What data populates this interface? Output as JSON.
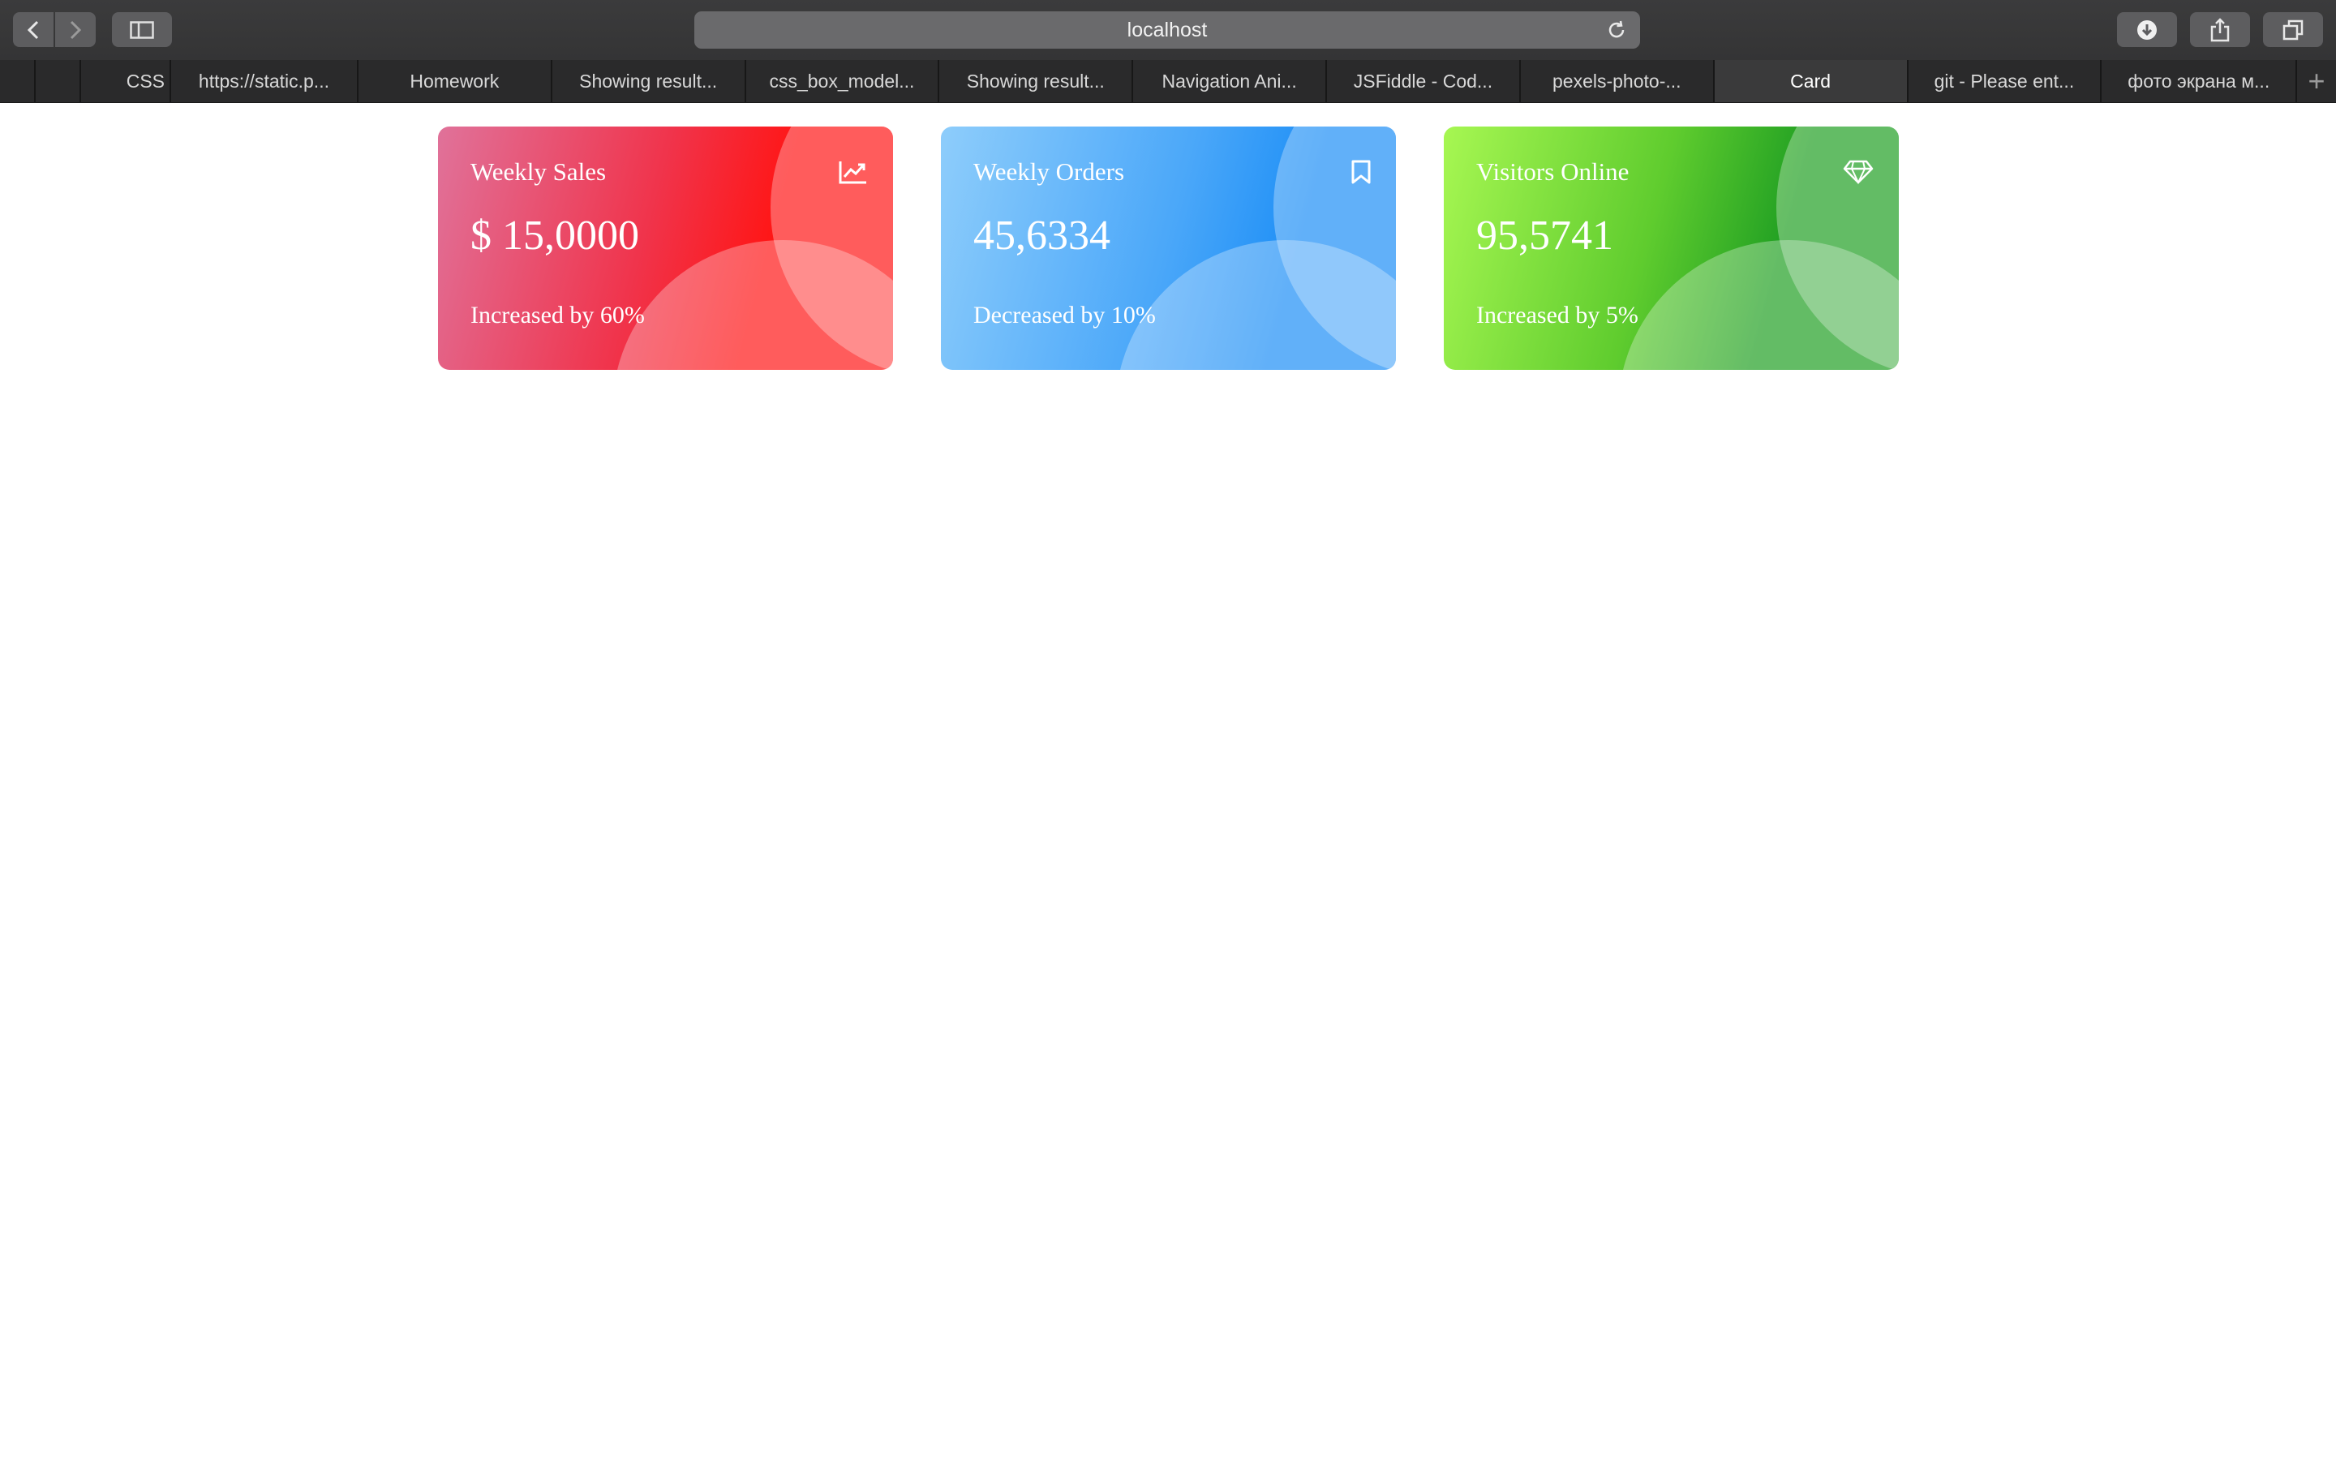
{
  "browser": {
    "address": "localhost",
    "tabs": [
      {
        "label": "",
        "pinned": true
      },
      {
        "label": "",
        "pinned": true
      },
      {
        "label": "CSS",
        "pinned": false,
        "width": "narrow"
      },
      {
        "label": "https://static.p...",
        "pinned": false
      },
      {
        "label": "Homework",
        "pinned": false
      },
      {
        "label": "Showing result...",
        "pinned": false
      },
      {
        "label": "css_box_model...",
        "pinned": false
      },
      {
        "label": "Showing result...",
        "pinned": false
      },
      {
        "label": "Navigation Ani...",
        "pinned": false
      },
      {
        "label": "JSFiddle - Cod...",
        "pinned": false
      },
      {
        "label": "pexels-photo-...",
        "pinned": false
      },
      {
        "label": "Card",
        "pinned": false,
        "active": true
      },
      {
        "label": "git - Please ent...",
        "pinned": false
      },
      {
        "label": "фото экрана м...",
        "pinned": false
      }
    ],
    "new_tab_symbol": "+"
  },
  "cards": [
    {
      "title": "Weekly Sales",
      "value": "$ 15,0000",
      "note": "Increased by 60%",
      "icon": "trending-up-icon"
    },
    {
      "title": "Weekly Orders",
      "value": "45,6334",
      "note": "Decreased by 10%",
      "icon": "bookmark-icon"
    },
    {
      "title": "Visitors Online",
      "value": "95,5741",
      "note": "Increased by 5%",
      "icon": "diamond-icon"
    }
  ],
  "colors": {
    "sales": "#f0344c",
    "orders": "#4aa7f9",
    "visitors": "#5fcc2e"
  }
}
